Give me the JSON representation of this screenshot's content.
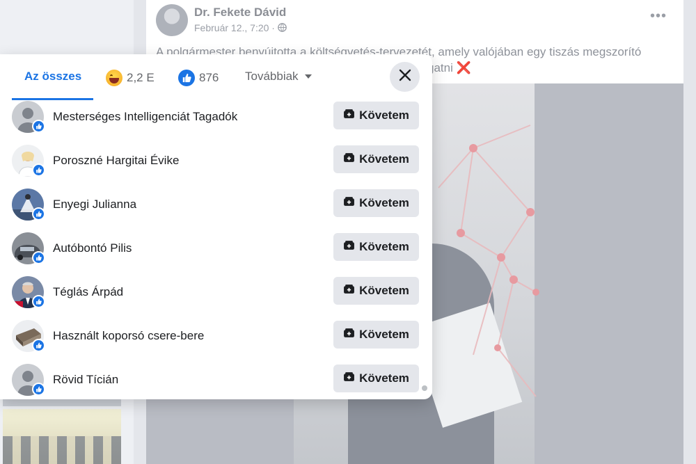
{
  "post": {
    "author": "Dr. Fekete Dávid",
    "meta": "Február 12., 7:20 ·",
    "text_line1": "A polgármester benyújtotta a költségvetés-tervezetét, amely valójában egy tiszás megszorító",
    "text_line2": "gatni ❌"
  },
  "reactions": {
    "tabs": [
      {
        "label": "Az összes",
        "icon": ""
      },
      {
        "label": "2,2 E",
        "icon": "haha-emoji-icon"
      },
      {
        "label": "876",
        "icon": "like-icon"
      },
      {
        "label": "Továbbiak",
        "icon": "caret-down-icon"
      }
    ],
    "follow_label": "Követem",
    "people": [
      {
        "name": "Mesterséges Intelligenciát Tagadók",
        "avatar": "default-avatar"
      },
      {
        "name": "Poroszné Hargitai Évike",
        "avatar": "photo-avatar"
      },
      {
        "name": "Enyegi Julianna",
        "avatar": "photo-avatar"
      },
      {
        "name": "Autóbontó Pilis",
        "avatar": "photo-avatar"
      },
      {
        "name": "Téglás Árpád",
        "avatar": "photo-avatar"
      },
      {
        "name": "Használt koporsó csere-bere",
        "avatar": "photo-avatar"
      },
      {
        "name": "Rövid Tícián",
        "avatar": "default-avatar"
      }
    ]
  },
  "colors": {
    "accent": "#1b74e4",
    "button_bg": "#e4e6eb",
    "text": "#1c1e21"
  }
}
